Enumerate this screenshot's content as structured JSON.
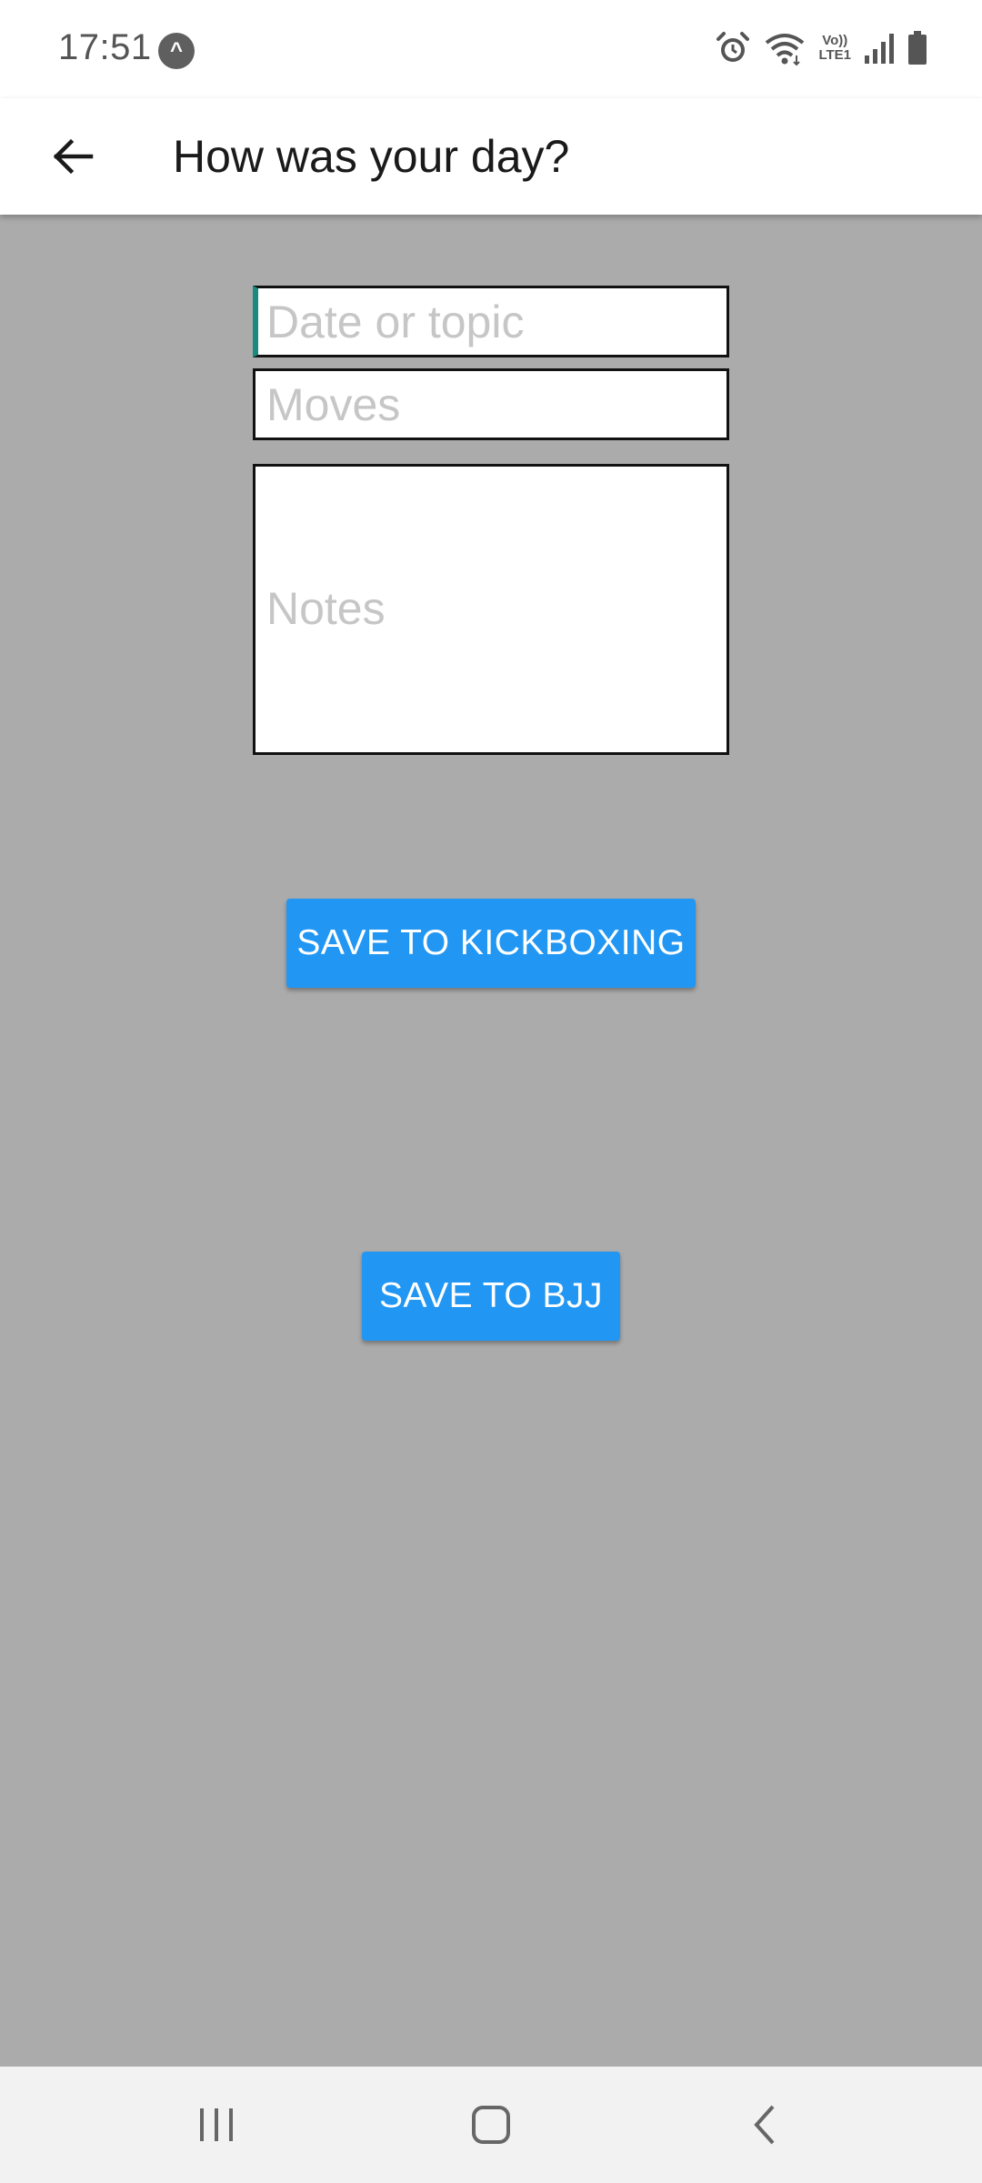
{
  "status_bar": {
    "time": "17:51",
    "volte_label_top": "Vo))",
    "volte_label_bottom": "LTE1",
    "icons": [
      "app-notification-icon",
      "alarm-icon",
      "wifi-icon",
      "volte-icon",
      "signal-icon",
      "battery-icon"
    ]
  },
  "app_bar": {
    "title": "How was your day?",
    "back_icon": "arrow-left-icon"
  },
  "form": {
    "topic_placeholder": "Date or topic",
    "topic_value": "",
    "moves_placeholder": "Moves",
    "moves_value": "",
    "notes_placeholder": "Notes",
    "notes_value": ""
  },
  "buttons": {
    "save_kickboxing": "SAVE TO KICKBOXING",
    "save_bjj": "SAVE TO BJJ"
  },
  "colors": {
    "background": "#ababab",
    "button": "#2196f3",
    "cursor_accent": "#1a8a80"
  },
  "nav_bar": {
    "icons": [
      "recents-icon",
      "home-icon",
      "back-chevron-icon"
    ]
  }
}
